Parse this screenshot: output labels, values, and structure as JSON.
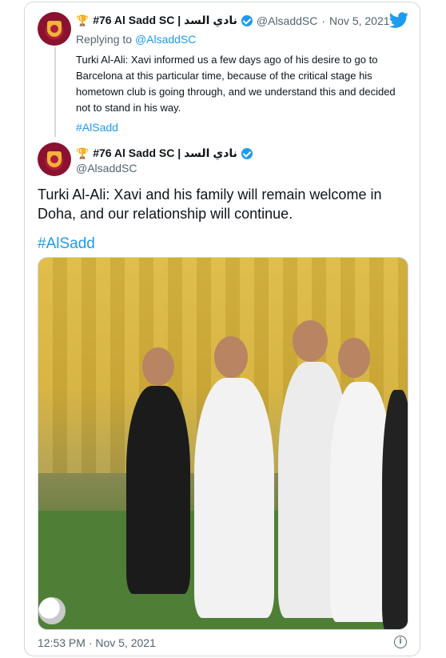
{
  "tweets": [
    {
      "display_name": "#76 Al Sadd SC | نادي السد",
      "handle": "@AlsaddSC",
      "date": "Nov 5, 2021",
      "reply_to_prefix": "Replying to ",
      "reply_to": "@AlsaddSC",
      "text": "Turki Al-Ali: Xavi informed us a few days ago of his desire to go to Barcelona at this particular time, because of the critical stage his hometown club is going through, and we understand this and decided not to stand in his way.",
      "hashtag": "#AlSadd"
    },
    {
      "display_name": "#76 Al Sadd SC | نادي السد",
      "handle": "@AlsaddSC",
      "text": "Turki Al-Ali: Xavi and his family will remain welcome in Doha, and our relationship will continue.",
      "hashtag": "#AlSadd",
      "timestamp": "12:53 PM · Nov 5, 2021"
    }
  ],
  "icons": {
    "trophy": "🏆",
    "twitter": "twitter-bird-icon",
    "verified": "verified-badge-icon",
    "info": "i"
  },
  "colors": {
    "link": "#1d9bf0",
    "muted": "#536471",
    "text": "#0f1419",
    "border": "#cfd9de"
  }
}
